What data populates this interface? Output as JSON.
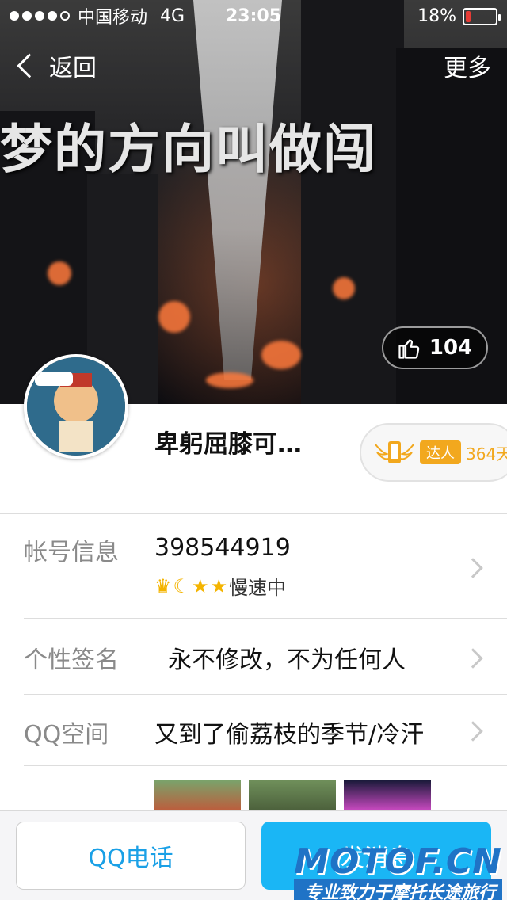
{
  "status_bar": {
    "carrier": "中国移动",
    "network": "4G",
    "time": "23:05",
    "battery_percent": "18%",
    "battery_level": 0.18,
    "signal_bars_filled": 4,
    "signal_bars_total": 5
  },
  "nav": {
    "back_label": "返回",
    "more_label": "更多"
  },
  "cover": {
    "title": "梦的方向叫做闯"
  },
  "likes": {
    "count": "104",
    "icon": "thumbs-up-icon"
  },
  "profile": {
    "nickname": "卑躬屈膝可…",
    "talent_tag": "达人",
    "talent_days": "364天"
  },
  "rows": {
    "account": {
      "label": "帐号信息",
      "value": "398544919",
      "status": "慢速中",
      "level_icons": [
        "crown-icon",
        "moon-icon",
        "star-icon",
        "star-icon"
      ]
    },
    "signature": {
      "label": "个性签名",
      "value": "永不修改，不为任何人"
    },
    "qzone": {
      "label": "QQ空间",
      "value": "又到了偷荔枝的季节/冷汗"
    }
  },
  "buttons": {
    "call_label": "QQ电话",
    "message_label": "发消息"
  },
  "watermark": {
    "brand": "MOTOF.CN",
    "slogan": "专业致力于摩托长途旅行"
  },
  "colors": {
    "accent": "#1ab6f5",
    "call_text": "#1aa0e6",
    "talent": "#f2a81e",
    "battery_low": "#e63b35"
  }
}
